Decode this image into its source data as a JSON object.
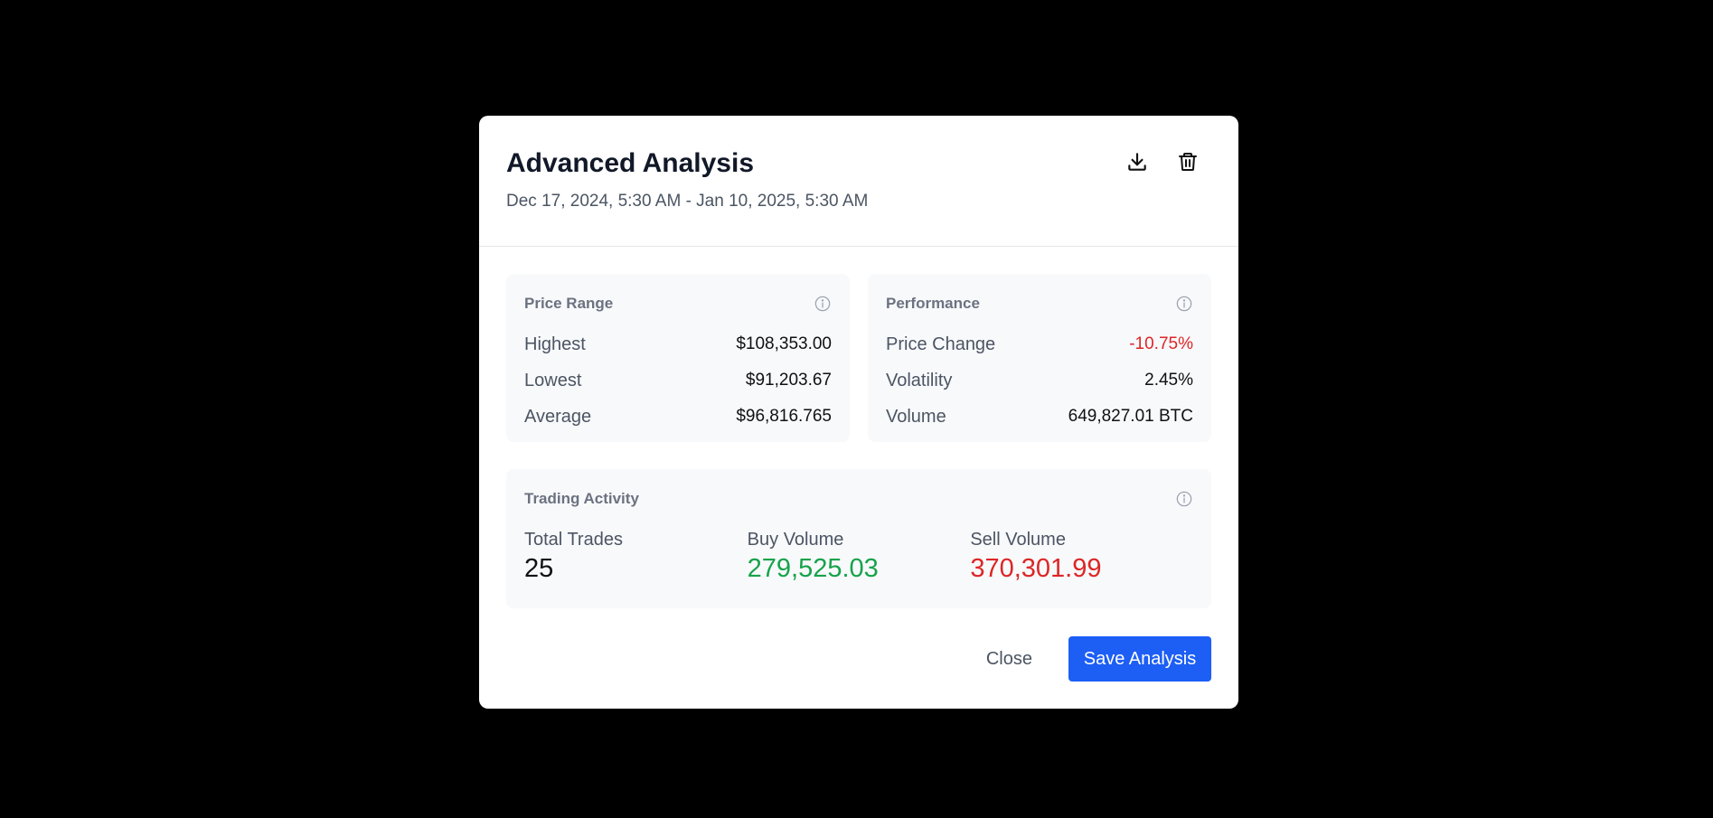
{
  "modal": {
    "title": "Advanced Analysis",
    "subtitle": "Dec 17, 2024, 5:30 AM - Jan 10, 2025, 5:30 AM",
    "icons": {
      "download": "download-icon",
      "delete": "trash-icon",
      "info": "info-icon"
    }
  },
  "price_range": {
    "title": "Price Range",
    "rows": [
      {
        "label": "Highest",
        "value": "$108,353.00"
      },
      {
        "label": "Lowest",
        "value": "$91,203.67"
      },
      {
        "label": "Average",
        "value": "$96,816.765"
      }
    ]
  },
  "performance": {
    "title": "Performance",
    "rows": [
      {
        "label": "Price Change",
        "value": "-10.75%"
      },
      {
        "label": "Volatility",
        "value": "2.45%"
      },
      {
        "label": "Volume",
        "value": "649,827.01 BTC"
      }
    ]
  },
  "trading_activity": {
    "title": "Trading Activity",
    "total_trades_label": "Total Trades",
    "total_trades_value": "25",
    "buy_volume_label": "Buy Volume",
    "buy_volume_value": "279,525.03",
    "sell_volume_label": "Sell Volume",
    "sell_volume_value": "370,301.99"
  },
  "footer": {
    "close_label": "Close",
    "save_label": "Save Analysis"
  },
  "colors": {
    "accent": "#1d5ef5",
    "negative": "#dc2626",
    "positive": "#16a34a",
    "backdrop": "#000000"
  }
}
